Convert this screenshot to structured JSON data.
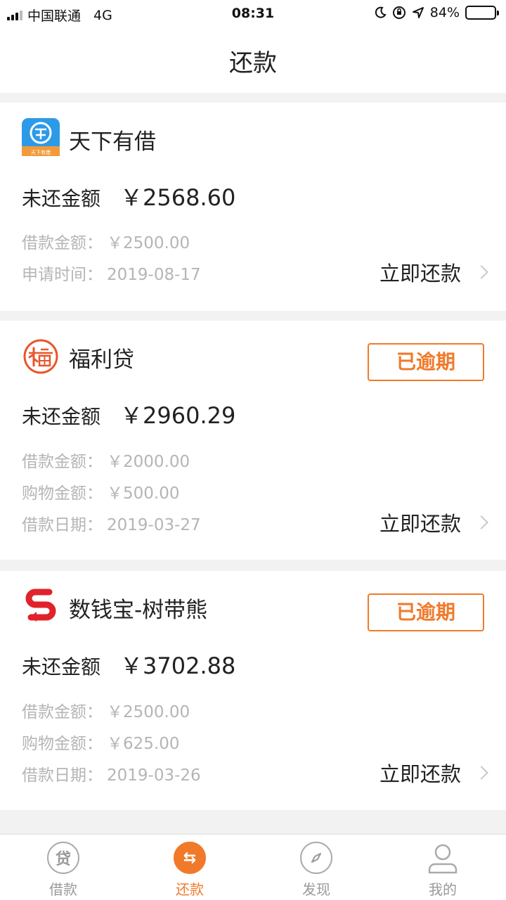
{
  "status_bar": {
    "carrier": "中国联通",
    "network": "4G",
    "time": "08:31",
    "battery": "84%",
    "battery_level": 0.84
  },
  "nav": {
    "title": "还款"
  },
  "cards": [
    {
      "name": "天下有借",
      "logo": "tianxia-logo-icon",
      "logo_text": "天下有借",
      "overdue": null,
      "outstanding_label": "未还金额",
      "outstanding_value": "￥2568.60",
      "details": [
        {
          "label": "借款金额：",
          "value": "￥2500.00"
        },
        {
          "label": "申请时间：",
          "value": "2019-08-17"
        }
      ],
      "repay_label": "立即还款"
    },
    {
      "name": "福利贷",
      "logo": "fu-logo-icon",
      "overdue": "已逾期",
      "outstanding_label": "未还金额",
      "outstanding_value": "￥2960.29",
      "details": [
        {
          "label": "借款金额：",
          "value": "￥2000.00"
        },
        {
          "label": "购物金额：",
          "value": "￥500.00"
        },
        {
          "label": "借款日期：",
          "value": "2019-03-27"
        }
      ],
      "repay_label": "立即还款"
    },
    {
      "name": "数钱宝-树带熊",
      "logo": "s-logo-icon",
      "overdue": "已逾期",
      "outstanding_label": "未还金额",
      "outstanding_value": "￥3702.88",
      "details": [
        {
          "label": "借款金额：",
          "value": "￥2500.00"
        },
        {
          "label": "购物金额：",
          "value": "￥625.00"
        },
        {
          "label": "借款日期：",
          "value": "2019-03-26"
        }
      ],
      "repay_label": "立即还款"
    }
  ],
  "tabs": [
    {
      "label": "借款",
      "icon": "loan-icon",
      "glyph": "贷",
      "active": false
    },
    {
      "label": "还款",
      "icon": "repay-icon",
      "glyph": "⇆",
      "active": true
    },
    {
      "label": "发现",
      "icon": "compass-icon",
      "active": false
    },
    {
      "label": "我的",
      "icon": "user-icon",
      "active": false
    }
  ],
  "colors": {
    "accent": "#f07a2a",
    "muted": "#b5b5b5",
    "background": "#f2f2f2"
  }
}
